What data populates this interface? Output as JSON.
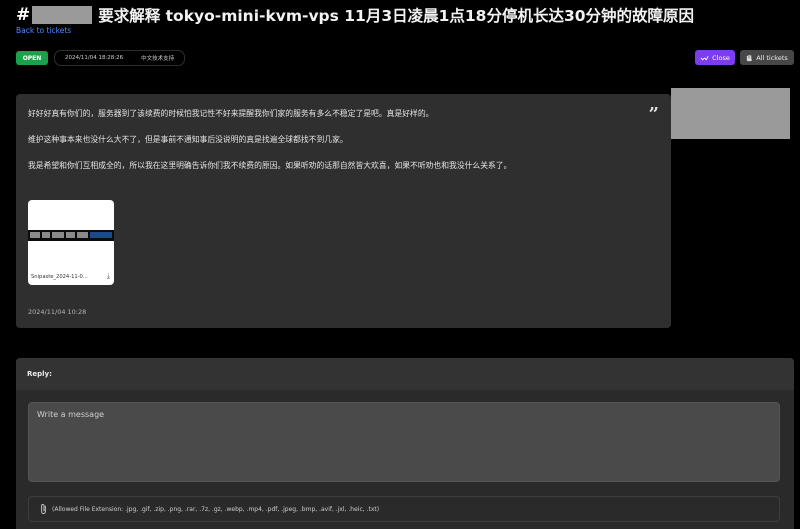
{
  "header": {
    "hash": "#",
    "title": "要求解释 tokyo-mini-kvm-vps 11月3日凌晨1点18分停机长达30分钟的故障原因",
    "back_link": "Back to tickets"
  },
  "status": {
    "badge": "OPEN",
    "datetime": "2024/11/04 18:28:26",
    "department": "中文技术支持"
  },
  "actions": {
    "close_label": "Close",
    "all_tickets_label": "All tickets"
  },
  "message": {
    "lines": [
      "好好好真有你们的，服务器到了该续费的时候怕我记性不好来提醒我你们家的服务有多么不稳定了是吧。真是好样的。",
      "维护这种事本来也没什么大不了，但是事前不通知事后没说明的真是找遍全球都找不到几家。",
      "我是希望和你们互相成全的，所以我在这里明确告诉你们我不续费的原因。如果听劝的话那自然皆大欢喜，如果不听劝也和我没什么关系了。"
    ],
    "quote_icon": "quote-icon",
    "attachment": {
      "filename": "Snipaste_2024-11-0...",
      "icon": "download-icon"
    },
    "time": "2024/11/04 10:28"
  },
  "reply": {
    "label": "Reply:",
    "placeholder": "Write a message",
    "allowed_extensions": "(Allowed File Extension: .jpg, .gif, .zip, .png, .rar, .7z, .gz, .webp, .mp4, .pdf, .jpeg, .bmp, .avif, .jxl, .heic, .txt)",
    "attach_icon": "paperclip-icon"
  },
  "colors": {
    "open_badge": "#1aa14b",
    "close_button": "#7c3cf0",
    "all_tickets_button": "#474747",
    "link": "#4d8cff"
  }
}
